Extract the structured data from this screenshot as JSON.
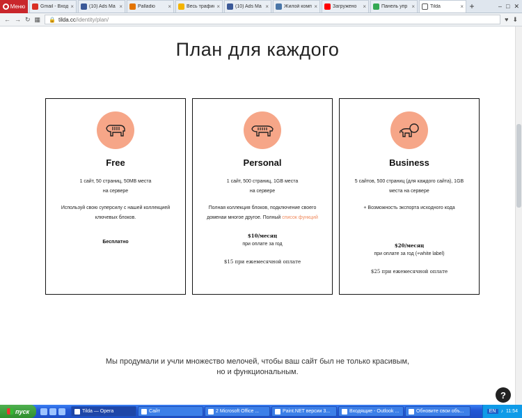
{
  "browser": {
    "menu_label": "Меню",
    "tabs": [
      {
        "label": "Gmail - Входя",
        "icon": "gmail-icon",
        "color": "#d93025"
      },
      {
        "label": "(10) Ads Ma",
        "icon": "facebook-icon",
        "color": "#3b5998"
      },
      {
        "label": "Palladio",
        "icon": "map-pin-icon",
        "color": "#e37400"
      },
      {
        "label": "Весь трафик",
        "icon": "analytics-icon",
        "color": "#f4b400"
      },
      {
        "label": "(10) Ads Ma",
        "icon": "facebook-icon",
        "color": "#3b5998"
      },
      {
        "label": "Жилой комп",
        "icon": "vk-icon",
        "color": "#4a76a8"
      },
      {
        "label": "Загружено",
        "icon": "youtube-icon",
        "color": "#ff0000"
      },
      {
        "label": "Панель упр",
        "icon": "dashboard-icon",
        "color": "#34a853"
      },
      {
        "label": "Tilda",
        "icon": "tilda-icon",
        "color": "#ffffff",
        "active": true
      }
    ],
    "new_tab": "+",
    "url_domain": "tilda.cc",
    "url_path": "/identity/plan/"
  },
  "page": {
    "heading": "План для каждого",
    "plans": [
      {
        "name": "Free",
        "icon": "bear-icon",
        "features": [
          "1 сайт, 50 страниц, 50MB места",
          "на сервере"
        ],
        "description": "Используй свою суперсилу с нашей коллекцией ключевых блоков.",
        "badge": "Бесплатно"
      },
      {
        "name": "Personal",
        "icon": "tiger-icon",
        "features": [
          "1 сайт, 500 страниц, 1GB места",
          "на сервере"
        ],
        "description": "Полная коллекция блоков, подключение своего доменаи многое другое. Полный",
        "link": "список функций",
        "price": "$10/месяц",
        "price_note": "при оплате за год",
        "monthly": "$15 при ежемесячной оплате"
      },
      {
        "name": "Business",
        "icon": "lion-icon",
        "features": [
          "5 сайтов, 500 страниц (для каждого сайта), 1GB",
          "места на сервере"
        ],
        "description": "+ Возможность экспорта исходного кода",
        "price": "$20/месяц",
        "price_note": "при оплате за год (+white label)",
        "monthly": "$25 при ежемесячной оплате"
      }
    ],
    "tagline": "Мы продумали и учли множество мелочей, чтобы ваш сайт был не только красивым, но и функциональным.",
    "help_label": "?"
  },
  "taskbar": {
    "start_label": "пуск",
    "tasks": [
      {
        "label": "Tilda — Opera",
        "active": true
      },
      {
        "label": "Сайт"
      },
      {
        "label": "2 Microsoft Office ..."
      },
      {
        "label": "Paint.NET версии 3..."
      },
      {
        "label": "Входящие - Outlook ..."
      },
      {
        "label": "Обновите свои объ..."
      }
    ],
    "lang": "EN",
    "clock": "11:54"
  },
  "colors": {
    "accent": "#f6a688",
    "link": "#f08a5d",
    "taskbar": "#245edb"
  }
}
